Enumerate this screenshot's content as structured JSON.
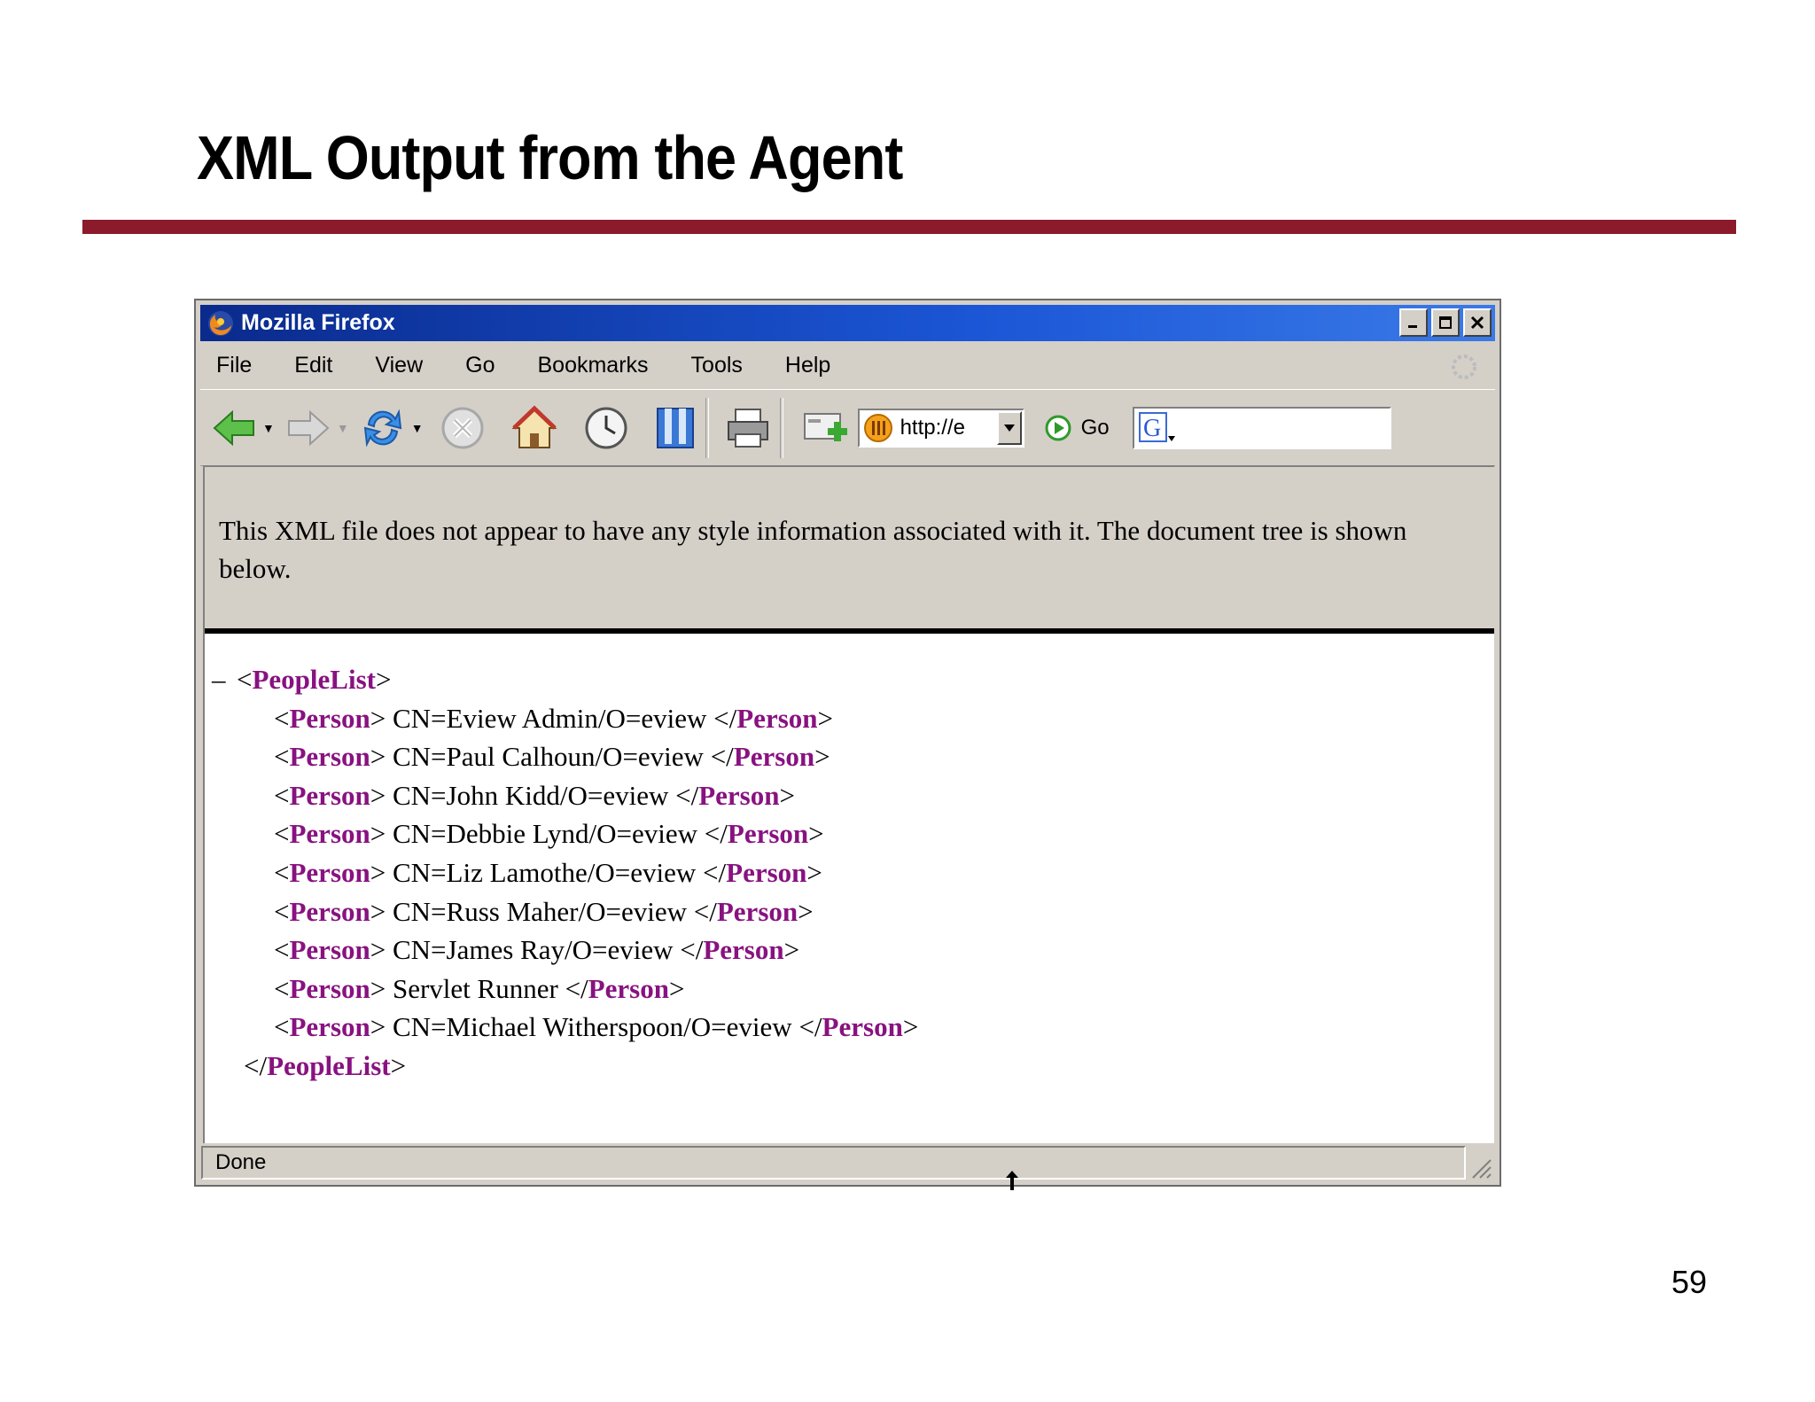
{
  "slide": {
    "title": "XML Output from the Agent",
    "page_number": "59"
  },
  "window": {
    "title": "Mozilla Firefox"
  },
  "menu": {
    "items": [
      "File",
      "Edit",
      "View",
      "Go",
      "Bookmarks",
      "Tools",
      "Help"
    ]
  },
  "toolbar": {
    "url": "http://e",
    "go_label": "Go"
  },
  "content": {
    "info_message": "This XML file does not appear to have any style information associated with it. The document tree is shown below.",
    "toggle": "–",
    "root_tag": "PeopleList",
    "child_tag": "Person",
    "people": [
      "CN=Eview Admin/O=eview",
      "CN=Paul Calhoun/O=eview",
      "CN=John Kidd/O=eview",
      "CN=Debbie Lynd/O=eview",
      "CN=Liz Lamothe/O=eview",
      "CN=Russ Maher/O=eview",
      "CN=James Ray/O=eview",
      "Servlet Runner",
      "CN=Michael Witherspoon/O=eview"
    ]
  },
  "status": {
    "text": "Done"
  },
  "colors": {
    "title_rule": "#8b1a2b",
    "xml_tag": "#881280",
    "titlebar": "#1b56d6"
  }
}
